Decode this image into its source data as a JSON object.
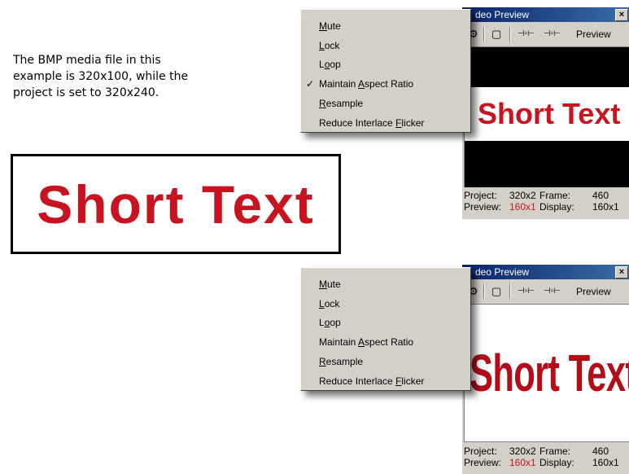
{
  "caption": {
    "line1": "The BMP media file in this",
    "line2": "example is 320x100, while the",
    "line3": "project is set to 320x240."
  },
  "sample": {
    "text": "Short Text",
    "color": "#c81420"
  },
  "windows": [
    {
      "title": "deo Preview",
      "close": "×",
      "toolbar": {
        "props": "⚙",
        "safe": "▢",
        "prev": "⊣▫⊢",
        "next": "⊣▫⊢",
        "preview_label": "Preview"
      },
      "screen_text": "Short Text",
      "status": {
        "project_label": "Project:",
        "project_value": "320x2",
        "frame_label": "Frame:",
        "frame_value": "460",
        "preview_label": "Preview:",
        "preview_value": "160x1",
        "display_label": "Display:",
        "display_value": "160x1"
      }
    },
    {
      "title": "deo Preview",
      "close": "×",
      "toolbar": {
        "props": "⚙",
        "safe": "▢",
        "prev": "⊣▫⊢",
        "next": "⊣▫⊢",
        "preview_label": "Preview"
      },
      "screen_text": "Short Text",
      "status": {
        "project_label": "Project:",
        "project_value": "320x2",
        "frame_label": "Frame:",
        "frame_value": "460",
        "preview_label": "Preview:",
        "preview_value": "160x1",
        "display_label": "Display:",
        "display_value": "160x1"
      }
    }
  ],
  "menus": [
    {
      "items": [
        {
          "pre": "",
          "key": "M",
          "post": "ute",
          "checked": false
        },
        {
          "pre": "",
          "key": "L",
          "post": "ock",
          "checked": false
        },
        {
          "pre": "L",
          "key": "o",
          "post": "op",
          "checked": false
        },
        {
          "pre": "Maintain ",
          "key": "A",
          "post": "spect Ratio",
          "checked": true
        },
        {
          "pre": "",
          "key": "R",
          "post": "esample",
          "checked": false
        },
        {
          "pre": "Reduce Interlace ",
          "key": "F",
          "post": "licker",
          "checked": false
        }
      ],
      "check_glyph": "✓"
    },
    {
      "items": [
        {
          "pre": "",
          "key": "M",
          "post": "ute",
          "checked": false
        },
        {
          "pre": "",
          "key": "L",
          "post": "ock",
          "checked": false
        },
        {
          "pre": "L",
          "key": "o",
          "post": "op",
          "checked": false
        },
        {
          "pre": "Maintain ",
          "key": "A",
          "post": "spect Ratio",
          "checked": false
        },
        {
          "pre": "",
          "key": "R",
          "post": "esample",
          "checked": false
        },
        {
          "pre": "Reduce Interlace ",
          "key": "F",
          "post": "licker",
          "checked": false
        }
      ],
      "check_glyph": ""
    }
  ]
}
